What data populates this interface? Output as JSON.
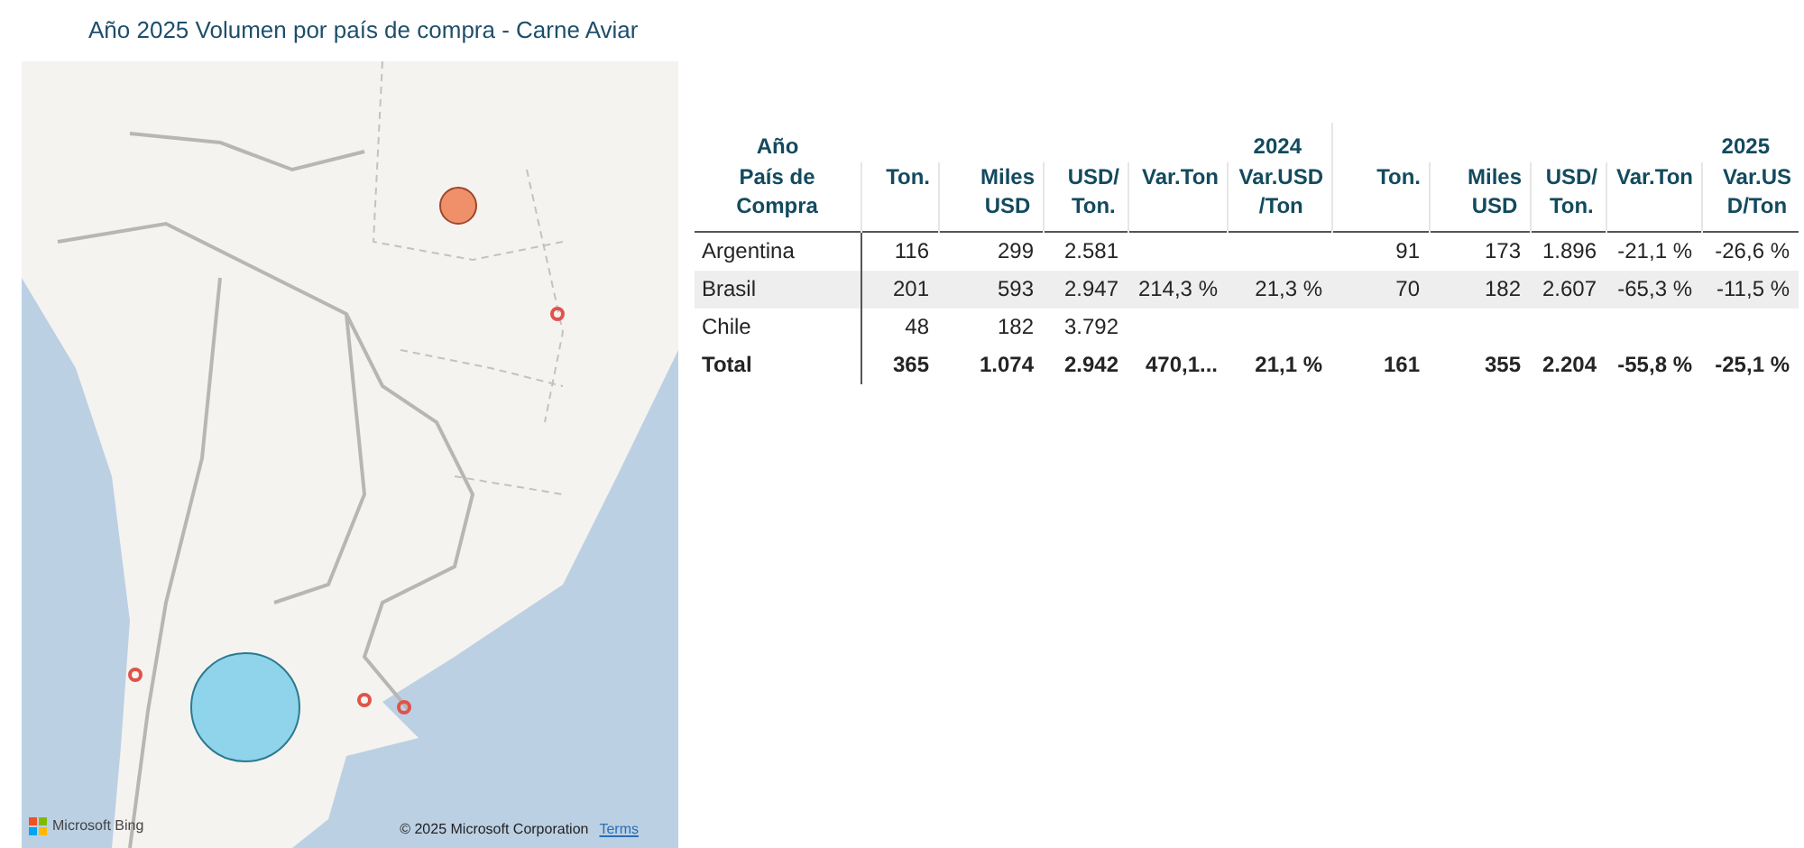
{
  "title": "Año 2025 Volumen por país de compra - Carne Aviar",
  "map": {
    "bubbles": [
      {
        "color": "#f0906b"
      },
      {
        "color": "#8fd4ea"
      }
    ],
    "logo_text": "Microsoft Bing",
    "copyright": "© 2025 Microsoft Corporation",
    "terms_link": "Terms"
  },
  "table": {
    "corner_labels": [
      "Año",
      "País de Compra"
    ],
    "years": [
      {
        "label": "2024",
        "columns": [
          "Ton.",
          "Miles USD",
          "USD/ Ton.",
          "Var.Ton",
          "Var.USD /Ton"
        ]
      },
      {
        "label": "2025",
        "columns": [
          "Ton.",
          "Miles USD",
          "USD/ Ton.",
          "Var.Ton",
          "Var.US D/Ton"
        ]
      }
    ],
    "rows": [
      {
        "country": "Argentina",
        "cells": [
          "116",
          "299",
          "2.581",
          "",
          "",
          "91",
          "173",
          "1.896",
          "-21,1 %",
          "-26,6 %"
        ]
      },
      {
        "country": "Brasil",
        "cells": [
          "201",
          "593",
          "2.947",
          "214,3 %",
          "21,3 %",
          "70",
          "182",
          "2.607",
          "-65,3 %",
          "-11,5 %"
        ]
      },
      {
        "country": "Chile",
        "cells": [
          "48",
          "182",
          "3.792",
          "",
          "",
          "",
          "",
          "",
          "",
          ""
        ]
      }
    ],
    "total": {
      "label": "Total",
      "cells": [
        "365",
        "1.074",
        "2.942",
        "470,1...",
        "21,1 %",
        "161",
        "355",
        "2.204",
        "-55,8 %",
        "-25,1 %"
      ]
    }
  }
}
